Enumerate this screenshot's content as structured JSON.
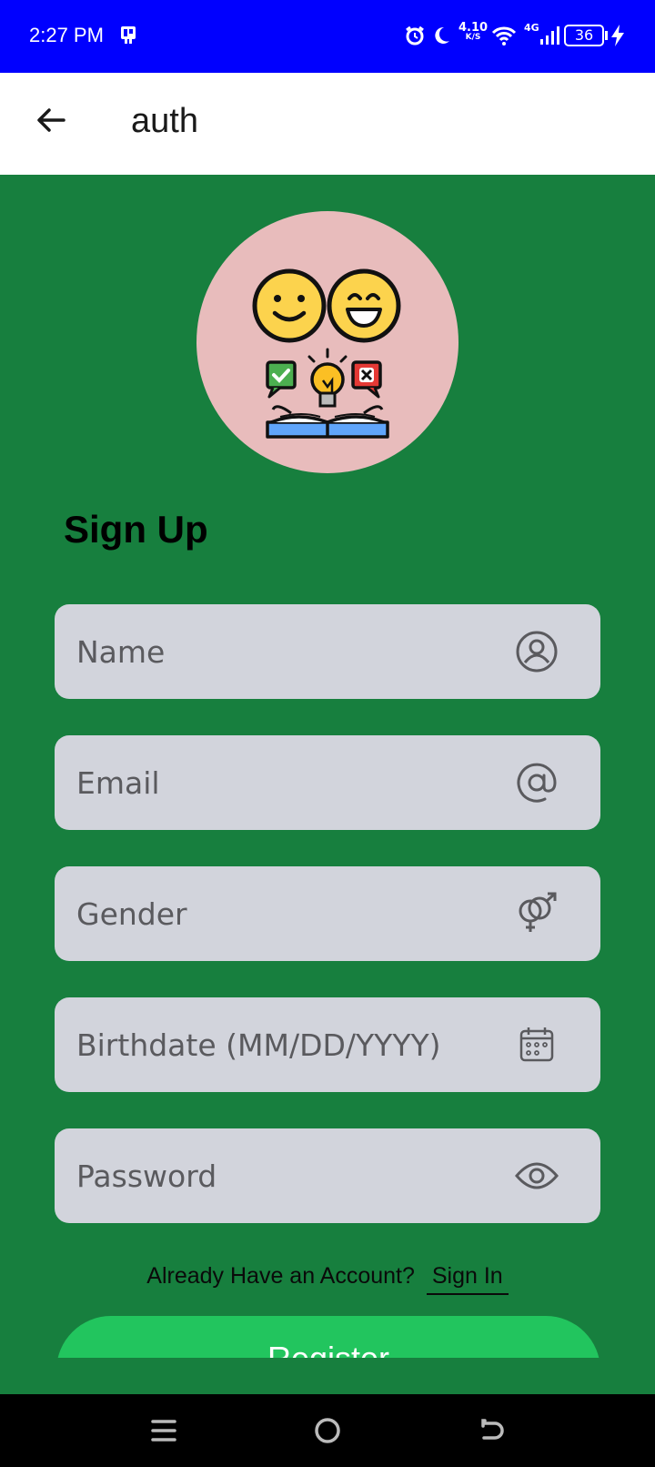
{
  "status_bar": {
    "time": "2:27 PM",
    "net_speed_value": "4.10",
    "net_speed_unit": "K/S",
    "network_type": "4G",
    "battery_level": "36",
    "icons": [
      "notification-icon",
      "alarm-icon",
      "moon-icon",
      "wifi-icon",
      "signal-icon",
      "battery-icon",
      "charging-icon"
    ]
  },
  "app_bar": {
    "title": "auth",
    "back_icon": "arrow-left-icon"
  },
  "logo": {
    "background_color": "#E8BCBC",
    "icons": [
      "smile-face-icon",
      "grin-face-icon",
      "check-bubble-icon",
      "lightbulb-icon",
      "cross-bubble-icon",
      "open-book-icon"
    ]
  },
  "form": {
    "heading": "Sign Up",
    "fields": [
      {
        "placeholder": "Name",
        "value": "",
        "icon": "user-circle-icon"
      },
      {
        "placeholder": "Email",
        "value": "",
        "icon": "at-sign-icon"
      },
      {
        "placeholder": "Gender",
        "value": "",
        "icon": "gender-icon"
      },
      {
        "placeholder": "Birthdate (MM/DD/YYYY)",
        "value": "",
        "icon": "calendar-icon"
      },
      {
        "placeholder": "Password",
        "value": "",
        "icon": "eye-icon"
      }
    ],
    "already_account_text": "Already Have an Account?",
    "sign_in_link": "Sign In",
    "register_button": "Register"
  },
  "nav_bar": {
    "icons": [
      "menu-icon",
      "home-icon",
      "back-icon"
    ]
  },
  "colors": {
    "status_bar": "#0000FF",
    "background": "#177F3E",
    "field": "#D2D4DC",
    "button": "#22C55E",
    "nav_bar": "#000000"
  }
}
